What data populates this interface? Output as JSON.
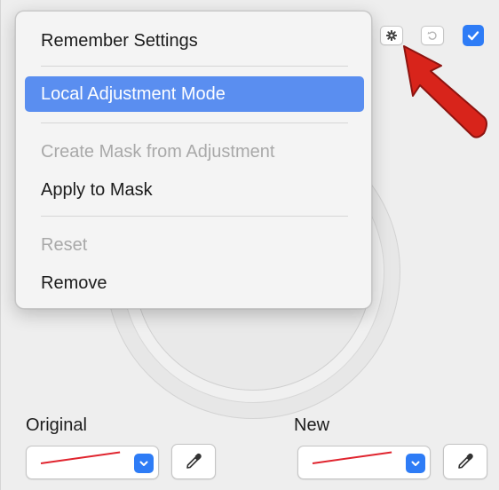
{
  "menu": {
    "items": [
      {
        "label": "Remember Settings",
        "state": "normal"
      },
      {
        "label": "Local Adjustment Mode",
        "state": "selected"
      },
      {
        "label": "Create Mask from Adjustment",
        "state": "disabled"
      },
      {
        "label": "Apply to Mask",
        "state": "normal"
      },
      {
        "label": "Reset",
        "state": "disabled"
      },
      {
        "label": "Remove",
        "state": "normal"
      }
    ]
  },
  "header": {
    "gear_icon": "gear-icon",
    "reset_icon": "undo-icon",
    "enabled_checked": true
  },
  "colors": {
    "highlight": "#5a8ef0",
    "accent": "#2e7cf6",
    "arrow": "#d8241b",
    "line_color": "#e0242e"
  },
  "footer": {
    "original_label": "Original",
    "new_label": "New"
  }
}
